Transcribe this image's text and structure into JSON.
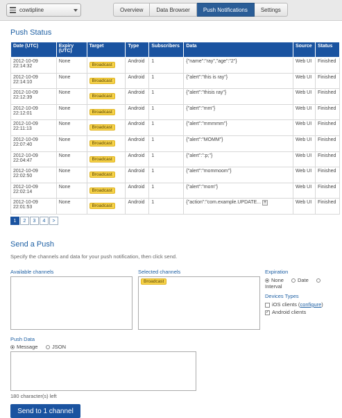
{
  "app": {
    "name": "cowtipline"
  },
  "tabs": [
    {
      "label": "Overview",
      "active": false
    },
    {
      "label": "Data Browser",
      "active": false
    },
    {
      "label": "Push Notifications",
      "active": true
    },
    {
      "label": "Settings",
      "active": false
    }
  ],
  "push_status": {
    "title": "Push Status",
    "columns": [
      "Date (UTC)",
      "Expiry (UTC)",
      "Target",
      "Type",
      "Subscribers",
      "Data",
      "Source",
      "Status"
    ],
    "rows": [
      {
        "date": "2012-10-09 22:14:32",
        "expiry": "None",
        "target": "Broadcast",
        "type": "Android",
        "subscribers": "1",
        "data": "{\"name\":\"ray\",\"age\":\"2\"}",
        "source": "Web UI",
        "status": "Finished"
      },
      {
        "date": "2012-10-09 22:14:10",
        "expiry": "None",
        "target": "Broadcast",
        "type": "Android",
        "subscribers": "1",
        "data": "{\"alert\":\"this is ray\"}",
        "source": "Web UI",
        "status": "Finished"
      },
      {
        "date": "2012-10-09 22:12:39",
        "expiry": "None",
        "target": "Broadcast",
        "type": "Android",
        "subscribers": "1",
        "data": "{\"alert\":\"thisis ray\"}",
        "source": "Web UI",
        "status": "Finished"
      },
      {
        "date": "2012-10-09 22:12:01",
        "expiry": "None",
        "target": "Broadcast",
        "type": "Android",
        "subscribers": "1",
        "data": "{\"alert\":\"mm\"}",
        "source": "Web UI",
        "status": "Finished"
      },
      {
        "date": "2012-10-09 22:11:13",
        "expiry": "None",
        "target": "Broadcast",
        "type": "Android",
        "subscribers": "1",
        "data": "{\"alert\":\"mmmmm\"}",
        "source": "Web UI",
        "status": "Finished"
      },
      {
        "date": "2012-10-09 22:07:40",
        "expiry": "None",
        "target": "Broadcast",
        "type": "Android",
        "subscribers": "1",
        "data": "{\"alert\":\"MOMM\"}",
        "source": "Web UI",
        "status": "Finished"
      },
      {
        "date": "2012-10-09 22:04:47",
        "expiry": "None",
        "target": "Broadcast",
        "type": "Android",
        "subscribers": "1",
        "data": "{\"alert\":\":p;\"}",
        "source": "Web UI",
        "status": "Finished"
      },
      {
        "date": "2012-10-09 22:02:50",
        "expiry": "None",
        "target": "Broadcast",
        "type": "Android",
        "subscribers": "1",
        "data": "{\"alert\":\"mommoom\"}",
        "source": "Web UI",
        "status": "Finished"
      },
      {
        "date": "2012-10-09 22:02:14",
        "expiry": "None",
        "target": "Broadcast",
        "type": "Android",
        "subscribers": "1",
        "data": "{\"alert\":\"mom\"}",
        "source": "Web UI",
        "status": "Finished"
      },
      {
        "date": "2012-10-09 22:01:53",
        "expiry": "None",
        "target": "Broadcast",
        "type": "Android",
        "subscribers": "1",
        "data": "{\"action\":\"com.example.UPDATE...",
        "source": "Web UI",
        "status": "Finished"
      }
    ],
    "pages": [
      "1",
      "2",
      "3",
      "4",
      ">"
    ]
  },
  "send_push": {
    "title": "Send a Push",
    "description": "Specify the channels and data for your push notification, then click send.",
    "available_channels_label": "Available channels",
    "selected_channels_label": "Selected channels",
    "selected_channel": "Broadcast",
    "expiration_label": "Expiration",
    "expiration_options": [
      "None",
      "Date",
      "Interval"
    ],
    "devices_label": "Devices Types",
    "ios_label": "iOS clients (",
    "ios_link": "configure",
    "ios_close": ")",
    "android_label": "Android clients",
    "push_data_label": "Push Data",
    "data_options": [
      "Message",
      "JSON"
    ],
    "chars_left": "180 character(s) left",
    "send_button": "Send to 1 channel"
  },
  "colors": {
    "accent": "#1a53a0",
    "badge": "#f6d24a"
  }
}
